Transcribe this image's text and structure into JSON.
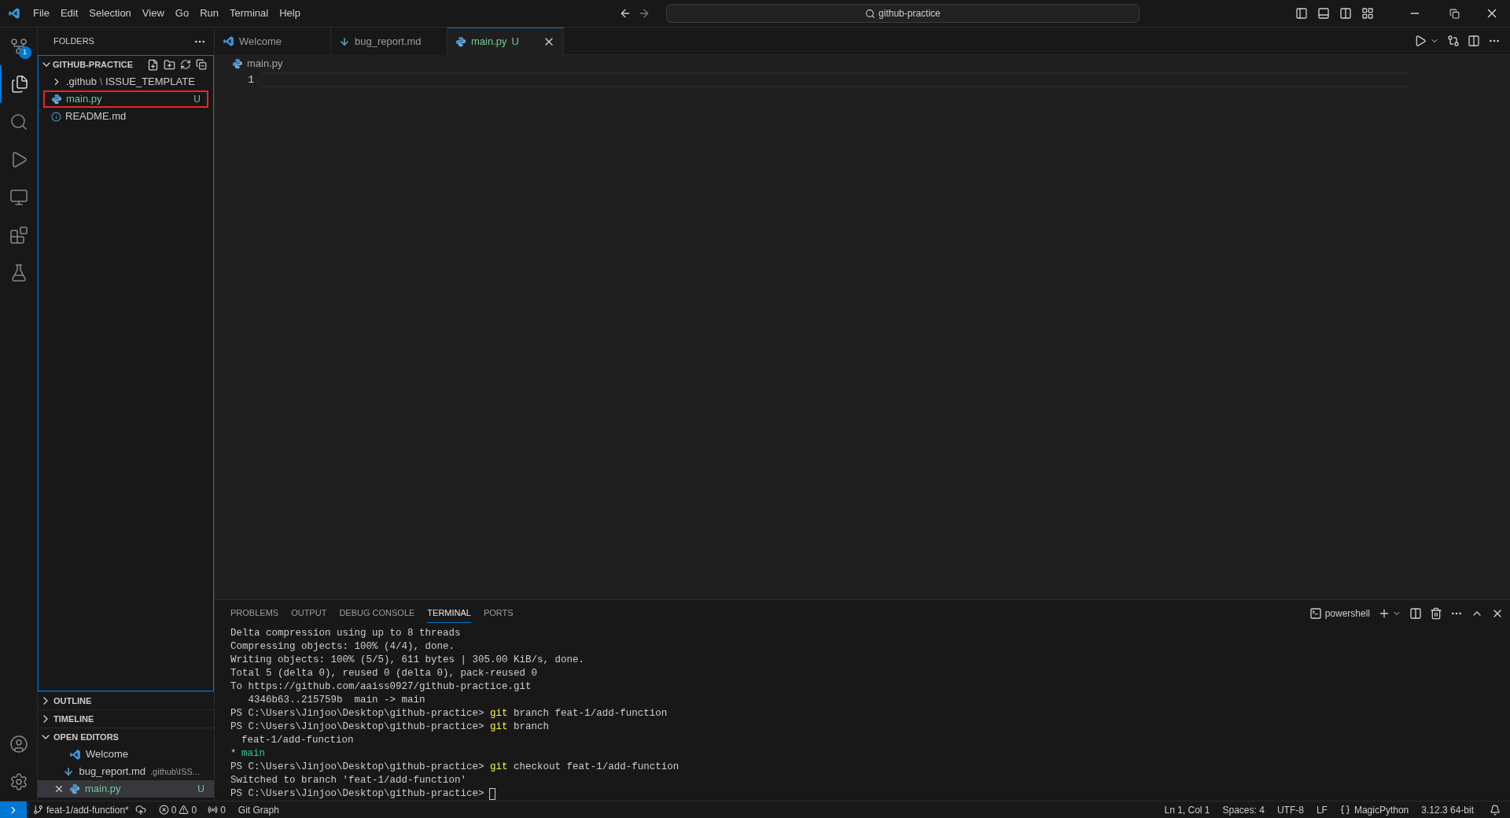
{
  "menu": [
    "File",
    "Edit",
    "Selection",
    "View",
    "Go",
    "Run",
    "Terminal",
    "Help"
  ],
  "command_center": {
    "value": "github-practice"
  },
  "activity_bar": [
    {
      "kind": "source-control",
      "selected": false,
      "badge": "1"
    },
    {
      "kind": "explorer",
      "selected": true
    },
    {
      "kind": "search",
      "selected": false
    },
    {
      "kind": "run-debug",
      "selected": false
    },
    {
      "kind": "remote",
      "selected": false
    },
    {
      "kind": "extensions",
      "selected": false
    },
    {
      "kind": "testing",
      "selected": false
    }
  ],
  "sidebar": {
    "title": "FOLDERS",
    "folder": {
      "name": "GITHUB-PRACTICE",
      "expanded": true
    },
    "tree": [
      {
        "kind": "folder",
        "name": ".github",
        "separator": "\\",
        "sub": "ISSUE_TEMPLATE",
        "expanded": false,
        "highlighted": false
      },
      {
        "kind": "python",
        "name": "main.py",
        "status": "U",
        "highlighted": true
      },
      {
        "kind": "info",
        "name": "README.md",
        "highlighted": false
      }
    ],
    "sections": [
      {
        "title": "OUTLINE",
        "expanded": false
      },
      {
        "title": "TIMELINE",
        "expanded": false
      },
      {
        "title": "OPEN EDITORS",
        "expanded": true
      }
    ],
    "open_editors": [
      {
        "kind": "vscode",
        "name": "Welcome",
        "selected": false
      },
      {
        "kind": "markdown",
        "name": "bug_report.md",
        "description": ".github\\ISS...",
        "selected": false
      },
      {
        "kind": "python",
        "name": "main.py",
        "status": "U",
        "selected": true
      }
    ]
  },
  "tabs": [
    {
      "kind": "vscode",
      "label": "Welcome",
      "selected": false
    },
    {
      "kind": "markdown",
      "label": "bug_report.md",
      "selected": false
    },
    {
      "kind": "python",
      "label": "main.py",
      "status": "U",
      "selected": true
    }
  ],
  "breadcrumb": "main.py",
  "editor": {
    "line_numbers": [
      "1"
    ]
  },
  "panel": {
    "tabs": [
      {
        "label": "PROBLEMS",
        "selected": false
      },
      {
        "label": "OUTPUT",
        "selected": false
      },
      {
        "label": "DEBUG CONSOLE",
        "selected": false
      },
      {
        "label": "TERMINAL",
        "selected": true
      },
      {
        "label": "PORTS",
        "selected": false
      }
    ],
    "shell": "powershell",
    "lines": [
      {
        "kind": "output",
        "text": "Delta compression using up to 8 threads"
      },
      {
        "kind": "output",
        "text": "Compressing objects: 100% (4/4), done."
      },
      {
        "kind": "output",
        "text": "Writing objects: 100% (5/5), 611 bytes | 305.00 KiB/s, done."
      },
      {
        "kind": "output",
        "text": "Total 5 (delta 0), reused 0 (delta 0), pack-reused 0"
      },
      {
        "kind": "output",
        "text": "To https://github.com/aaiss0927/github-practice.git"
      },
      {
        "kind": "output",
        "text": "   4346b63..215759b  main -> main"
      },
      {
        "kind": "command",
        "prompt": "PS C:\\Users\\Jinjoo\\Desktop\\github-practice>",
        "command": "git",
        "args": "branch feat-1/add-function"
      },
      {
        "kind": "command",
        "prompt": "PS C:\\Users\\Jinjoo\\Desktop\\github-practice>",
        "command": "git",
        "args": "branch"
      },
      {
        "kind": "branch",
        "name": "feat-1/add-function",
        "current": false
      },
      {
        "kind": "branch",
        "marker": "*",
        "name": "main",
        "current": true
      },
      {
        "kind": "command",
        "prompt": "PS C:\\Users\\Jinjoo\\Desktop\\github-practice>",
        "command": "git",
        "args": "checkout feat-1/add-function"
      },
      {
        "kind": "output",
        "text": "Switched to branch 'feat-1/add-function'"
      },
      {
        "kind": "cursor",
        "prompt": "PS C:\\Users\\Jinjoo\\Desktop\\github-practice>"
      }
    ]
  },
  "status_bar": {
    "branch": "feat-1/add-function*",
    "errors": "0",
    "warnings": "0",
    "ports": "0",
    "git_graph": "Git Graph",
    "right": [
      "Ln 1, Col 1",
      "Spaces: 4",
      "UTF-8",
      "LF"
    ],
    "language": "MagicPython",
    "interpreter": "3.12.3 64-bit"
  }
}
